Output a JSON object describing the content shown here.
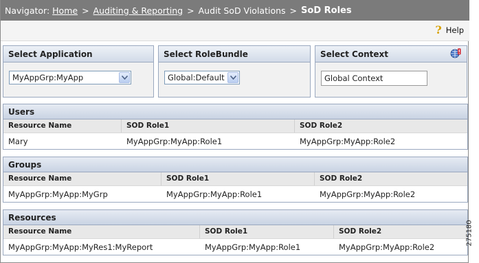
{
  "navigator": {
    "prefix": "Navigator:",
    "crumbs": [
      "Home",
      "Auditing & Reporting",
      "Audit SoD Violations"
    ],
    "separator": ">",
    "current": "SoD Roles"
  },
  "toolbar": {
    "help_label": "Help"
  },
  "selectors": {
    "application": {
      "title": "Select Application",
      "value": "MyAppGrp:MyApp"
    },
    "rolebundle": {
      "title": "Select RoleBundle",
      "value": "Global:Default"
    },
    "context": {
      "title": "Select Context",
      "value": "Global Context"
    }
  },
  "users": {
    "title": "Users",
    "columns": [
      "Resource Name",
      "SOD Role1",
      "SOD Role2"
    ],
    "rows": [
      [
        "Mary",
        "MyAppGrp:MyApp:Role1",
        "MyAppGrp:MyApp:Role2"
      ]
    ]
  },
  "groups": {
    "title": "Groups",
    "columns": [
      "Resource Name",
      "SOD Role1",
      "SOD Role2"
    ],
    "rows": [
      [
        "MyAppGrp:MyApp:MyGrp",
        "MyAppGrp:MyApp:Role1",
        "MyAppGrp:MyApp:Role2"
      ]
    ]
  },
  "resources": {
    "title": "Resources",
    "columns": [
      "Resource Name",
      "SOD Role1",
      "SOD Role2"
    ],
    "rows": [
      [
        "MyAppGrp:MyApp:MyRes1:MyReport",
        "MyAppGrp:MyApp:Role1",
        "MyAppGrp:MyApp:Role2"
      ]
    ]
  },
  "figure_id": "275180",
  "icons": {
    "help": "question-mark-icon",
    "context": "globe-icon",
    "dropdown": "chevron-down-icon"
  },
  "colors": {
    "navbar": "#7b7b7b",
    "panel_header": "#d2dbe8",
    "border": "#9aa8bf",
    "help_icon": "#d7a100"
  }
}
